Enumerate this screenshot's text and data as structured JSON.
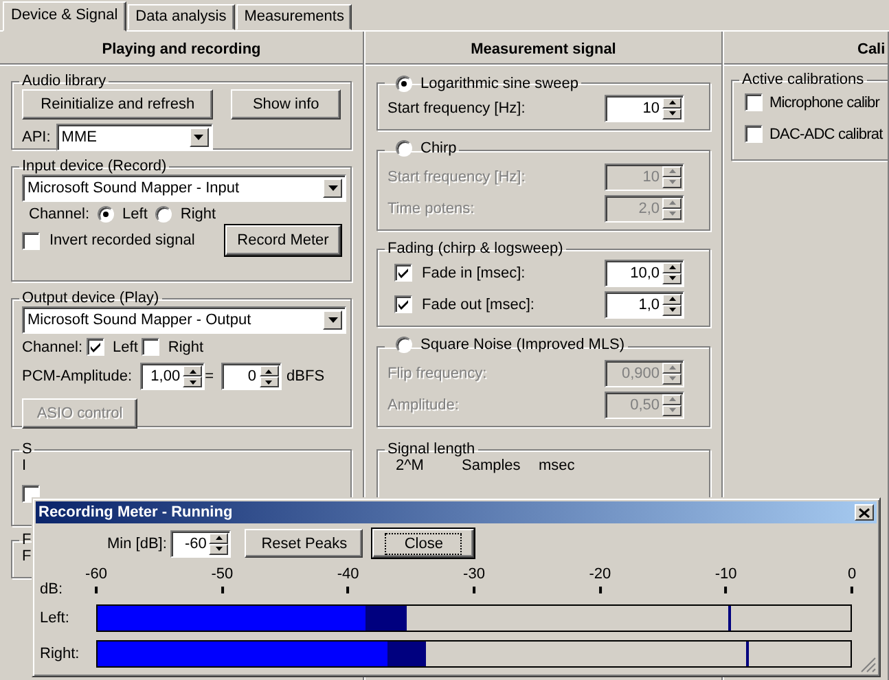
{
  "tabs": [
    {
      "label": "Device & Signal",
      "selected": true
    },
    {
      "label": "Data analysis",
      "selected": false
    },
    {
      "label": "Measurements",
      "selected": false
    }
  ],
  "playing": {
    "header": "Playing and recording",
    "audio_library": {
      "legend": "Audio library",
      "buttons": [
        "Reinitialize and refresh",
        "Show info"
      ],
      "api_label": "API:",
      "api_value": "MME"
    },
    "input_device": {
      "legend": "Input device (Record)",
      "device": "Microsoft Sound Mapper - Input",
      "channel_label": "Channel:",
      "channels": [
        {
          "label": "Left",
          "selected": true
        },
        {
          "label": "Right",
          "selected": false
        }
      ],
      "invert": {
        "label": "Invert recorded signal",
        "checked": false
      },
      "meter_button": "Record Meter"
    },
    "output_device": {
      "legend": "Output device (Play)",
      "device": "Microsoft Sound Mapper - Output",
      "channel_label": "Channel:",
      "channels": [
        {
          "label": "Left",
          "checked": true
        },
        {
          "label": "Right",
          "checked": false
        }
      ],
      "amplitude_label": "PCM-Amplitude:",
      "amplitude": "1,00",
      "equals": "=",
      "dbfs": "0",
      "dbfs_unit": "dBFS",
      "asio_button": {
        "label": "ASIO control",
        "disabled": true
      }
    },
    "group_3": {
      "legend": "S",
      "label": "I",
      "checked": false
    },
    "group_4": {
      "legend": "F",
      "label": "F"
    }
  },
  "measurement": {
    "header": "Measurement signal",
    "groups": [
      {
        "kind": "radio",
        "legend": "Logarithmic sine sweep",
        "selected": true,
        "disabled": false,
        "fields": [
          {
            "label": "Start frequency [Hz]:",
            "value": "10"
          }
        ]
      },
      {
        "kind": "radio",
        "legend": "Chirp",
        "selected": false,
        "disabled": true,
        "fields": [
          {
            "label": "Start frequency [Hz]:",
            "value": "10"
          },
          {
            "label": "Time potens:",
            "value": "2,0"
          }
        ]
      },
      {
        "kind": "plain",
        "legend": "Fading (chirp & logsweep)",
        "disabled": false,
        "fields": [
          {
            "label": "Fade in [msec]:",
            "value": "10,0",
            "checked": true
          },
          {
            "label": "Fade out [msec]:",
            "value": "1,0",
            "checked": true
          }
        ]
      },
      {
        "kind": "radio",
        "legend": "Square Noise (Improved MLS)",
        "selected": false,
        "disabled": true,
        "fields": [
          {
            "label": "Flip frequency:",
            "value": "0,900"
          },
          {
            "label": "Amplitude:",
            "value": "0,50"
          }
        ]
      }
    ],
    "signal_length": {
      "legend": "Signal length",
      "columns": [
        "2^M",
        "Samples",
        "msec"
      ]
    }
  },
  "calibration": {
    "header": "Cali",
    "legend": "Active calibrations",
    "items": [
      {
        "label": "Microphone calibr",
        "checked": false
      },
      {
        "label": "DAC-ADC calibrat",
        "checked": false
      }
    ]
  },
  "dialog": {
    "title": "Recording Meter - Running",
    "min_label": "Min [dB]:",
    "min_value": "-60",
    "reset_button": "Reset Peaks",
    "close_button": {
      "label": "Close",
      "focused": true
    },
    "scale_label": "dB:",
    "ticks": [
      "-60",
      "-50",
      "-40",
      "-30",
      "-20",
      "-10",
      "0"
    ],
    "channels": [
      {
        "label": "Left:",
        "level": 0.356,
        "hold": {
          "level": 0.41
        },
        "peak": {
          "level": 0.838
        }
      },
      {
        "label": "Right:",
        "level": 0.385,
        "hold": {
          "level": 0.436
        },
        "peak": {
          "level": 0.862
        }
      }
    ]
  }
}
